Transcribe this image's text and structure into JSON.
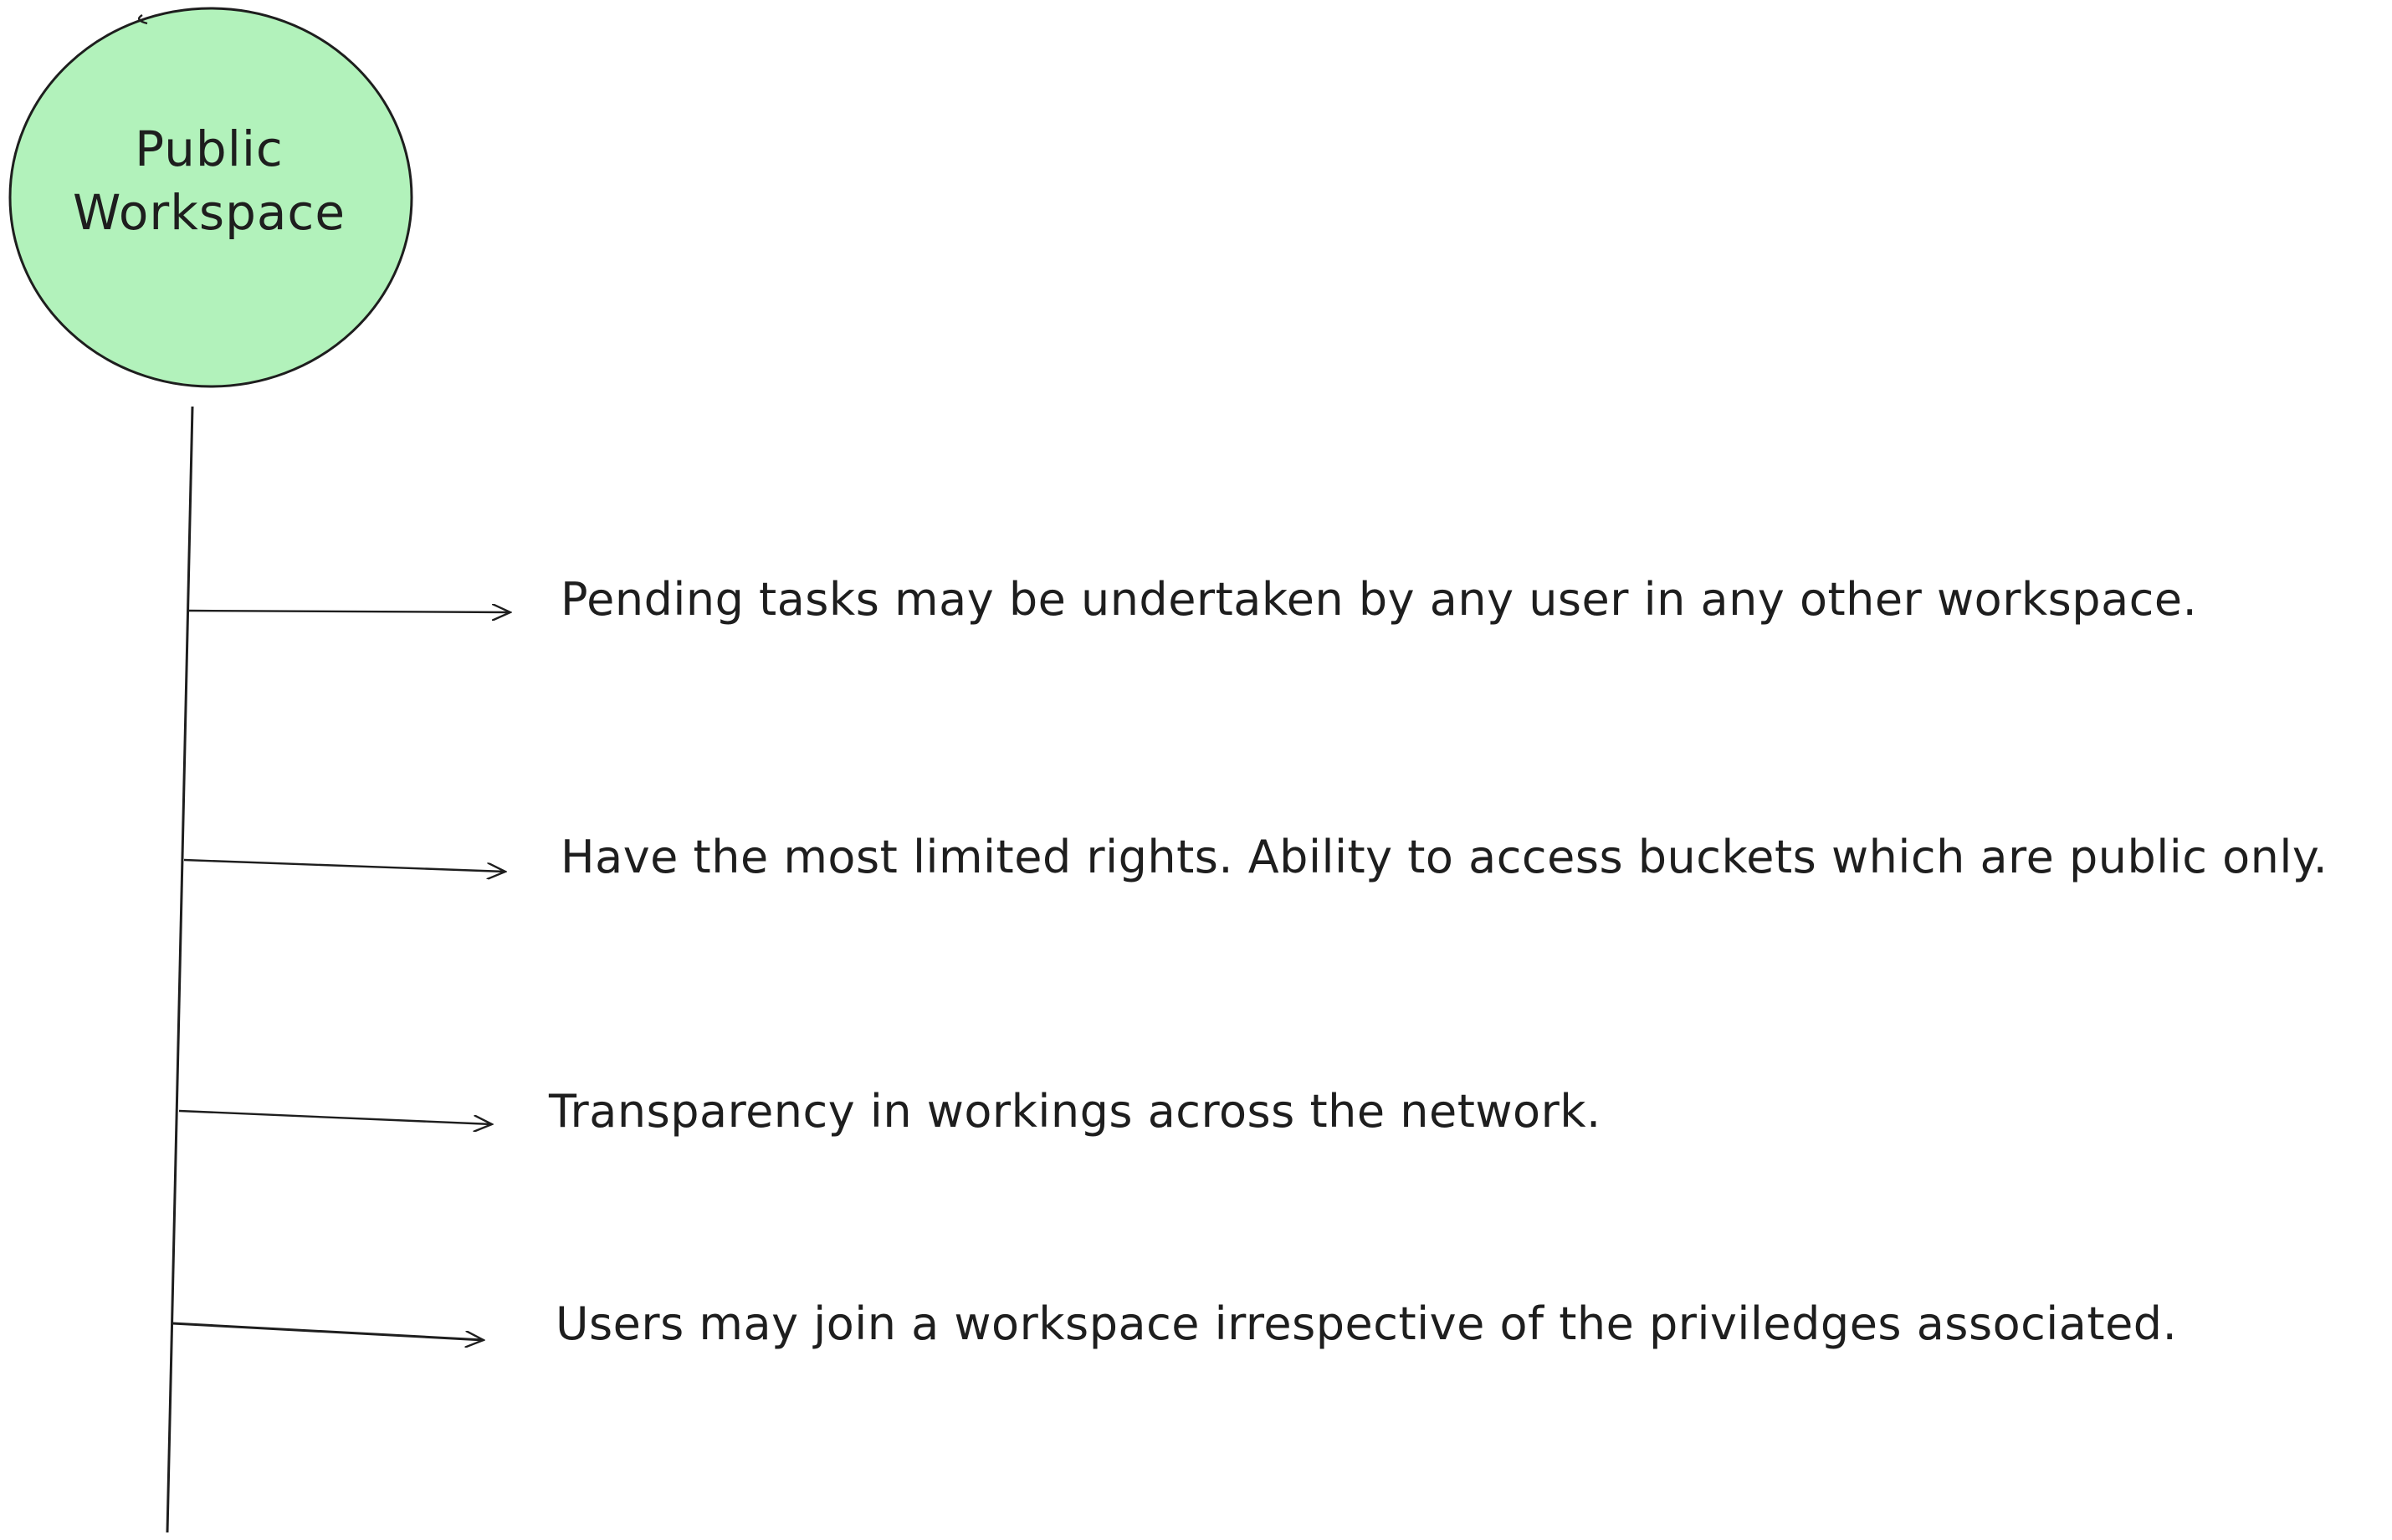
{
  "node": {
    "title_line1": "Public",
    "title_line2": "Workspace",
    "fill_color": "#b2f2bb",
    "stroke_color": "#1e1e1e"
  },
  "points": [
    {
      "text": "Pending tasks may be undertaken by any user in any other workspace."
    },
    {
      "text": "Have the most limited rights. Ability to access buckets which are public only."
    },
    {
      "text": "Transparency in workings across the network."
    },
    {
      "text": "Users may join a workspace irrespective of the priviledges associated."
    }
  ]
}
